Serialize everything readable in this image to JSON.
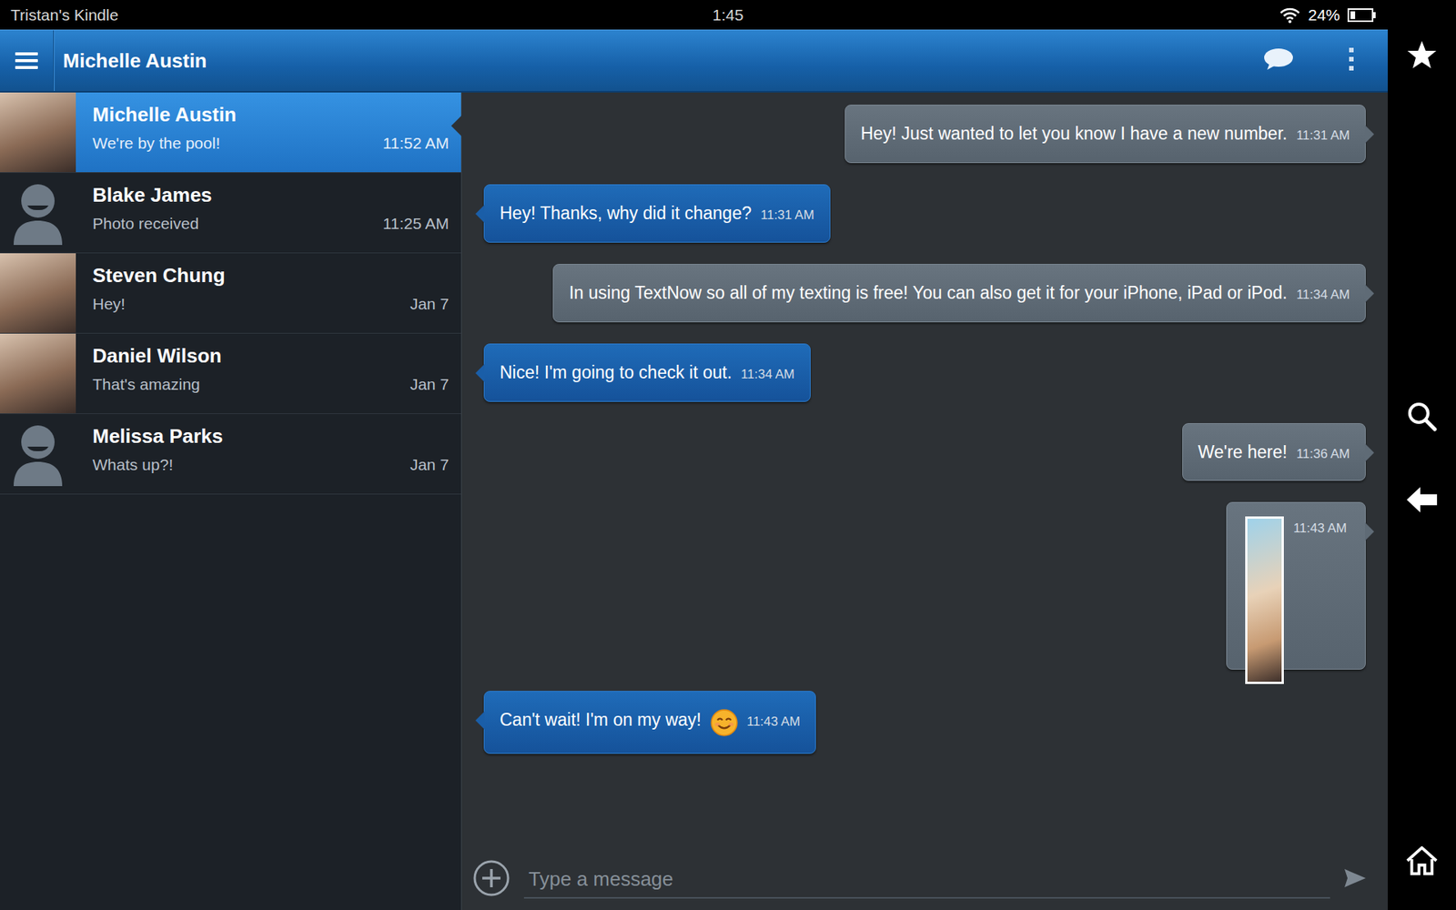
{
  "status_bar": {
    "device": "Tristan's Kindle",
    "time": "1:45",
    "battery": "24%",
    "battery_level": 0.24
  },
  "app_bar": {
    "title": "Michelle Austin"
  },
  "conversations": [
    {
      "name": "Michelle Austin",
      "preview": "We're by the pool!",
      "time": "11:52 AM",
      "selected": true,
      "kind": "photo"
    },
    {
      "name": "Blake James",
      "preview": "Photo received",
      "time": "11:25 AM",
      "selected": false,
      "kind": "placeholder"
    },
    {
      "name": "Steven Chung",
      "preview": "Hey!",
      "time": "Jan 7",
      "selected": false,
      "kind": "photo"
    },
    {
      "name": "Daniel Wilson",
      "preview": "That's amazing",
      "time": "Jan 7",
      "selected": false,
      "kind": "photo"
    },
    {
      "name": "Melissa Parks",
      "preview": "Whats up?!",
      "time": "Jan 7",
      "selected": false,
      "kind": "placeholder"
    }
  ],
  "messages": [
    {
      "outgoing": true,
      "kind": "text",
      "text": "Hey! Just wanted to let you know I have a new number.",
      "time": "11:31 AM",
      "emoji": false
    },
    {
      "outgoing": false,
      "kind": "text",
      "text": "Hey! Thanks, why did it change?",
      "time": "11:31 AM",
      "emoji": false
    },
    {
      "outgoing": true,
      "kind": "text",
      "text": "In using TextNow so all of my texting is free! You can also get it for your iPhone, iPad or iPod.",
      "time": "11:34 AM",
      "emoji": false
    },
    {
      "outgoing": false,
      "kind": "text",
      "text": "Nice! I'm going to check it out.",
      "time": "11:34 AM",
      "emoji": false
    },
    {
      "outgoing": true,
      "kind": "text",
      "text": "We're here!",
      "time": "11:36 AM",
      "emoji": false
    },
    {
      "outgoing": true,
      "kind": "photo",
      "text": "",
      "time": "11:43 AM",
      "emoji": false
    },
    {
      "outgoing": false,
      "kind": "text",
      "text": "Can't wait! I'm on my way!",
      "time": "11:43 AM",
      "emoji": true
    }
  ],
  "composer": {
    "placeholder": "Type a message"
  }
}
